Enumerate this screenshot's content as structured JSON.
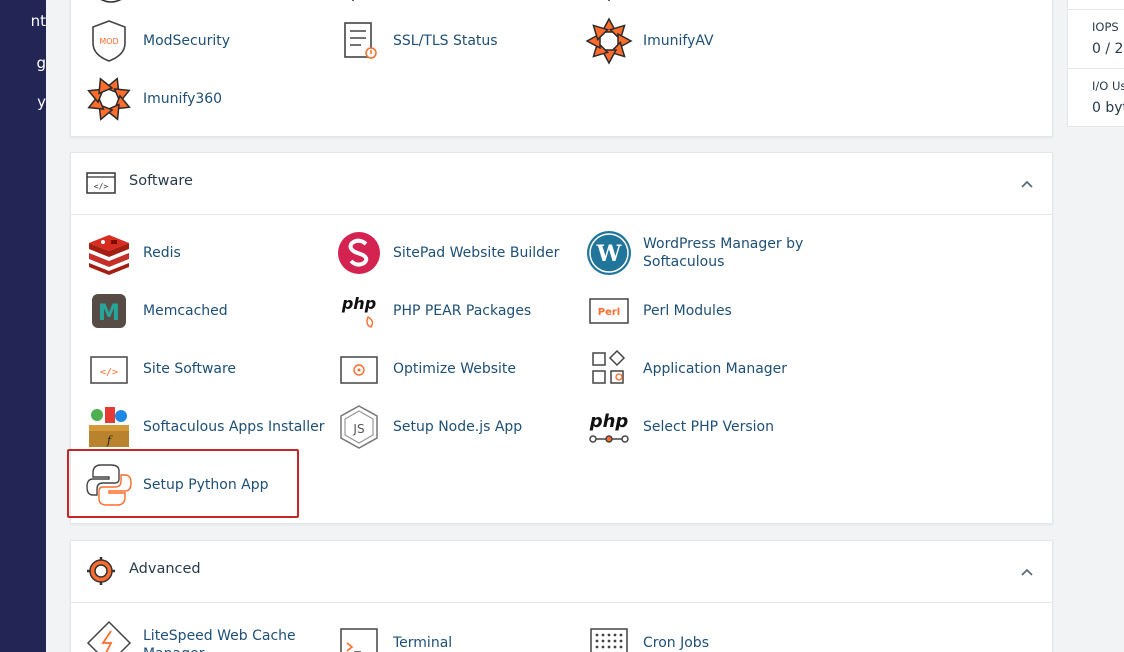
{
  "sidebar": {
    "fragments": [
      "nt",
      "g",
      "y"
    ]
  },
  "security": {
    "items": [
      {
        "label": "ModSecurity",
        "icon": "modsecurity-icon"
      },
      {
        "label": "SSL/TLS Status",
        "icon": "ssl-status-icon"
      },
      {
        "label": "ImunifyAV",
        "icon": "imunifyav-icon"
      },
      {
        "label": "Imunify360",
        "icon": "imunify360-icon"
      }
    ]
  },
  "software": {
    "title": "Software",
    "items": [
      {
        "label": "Redis",
        "icon": "redis-icon"
      },
      {
        "label": "SitePad Website Builder",
        "icon": "sitepad-icon"
      },
      {
        "label": "WordPress Manager by Softaculous",
        "icon": "wordpress-icon"
      },
      {
        "label": "Memcached",
        "icon": "memcached-icon"
      },
      {
        "label": "PHP PEAR Packages",
        "icon": "php-pear-icon"
      },
      {
        "label": "Perl Modules",
        "icon": "perl-icon"
      },
      {
        "label": "Site Software",
        "icon": "site-software-icon"
      },
      {
        "label": "Optimize Website",
        "icon": "optimize-icon"
      },
      {
        "label": "Application Manager",
        "icon": "app-manager-icon"
      },
      {
        "label": "Softaculous Apps Installer",
        "icon": "softaculous-icon"
      },
      {
        "label": "Setup Node.js App",
        "icon": "nodejs-icon"
      },
      {
        "label": "Select PHP Version",
        "icon": "php-version-icon"
      },
      {
        "label": "Setup Python App",
        "icon": "python-icon"
      }
    ]
  },
  "advanced": {
    "title": "Advanced",
    "items": [
      {
        "label": "LiteSpeed Web Cache Manager",
        "icon": "litespeed-icon"
      },
      {
        "label": "Terminal",
        "icon": "terminal-icon"
      },
      {
        "label": "Cron Jobs",
        "icon": "cron-icon"
      }
    ]
  },
  "stats": {
    "iops_label": "IOPS",
    "iops_value": "0 / 2,",
    "io_label": "I/O Us",
    "io_value": "0 byt"
  },
  "colors": {
    "sidebar": "#232554",
    "accent": "#ff6c2c",
    "link": "#1e4f76",
    "highlight": "#c62828"
  }
}
